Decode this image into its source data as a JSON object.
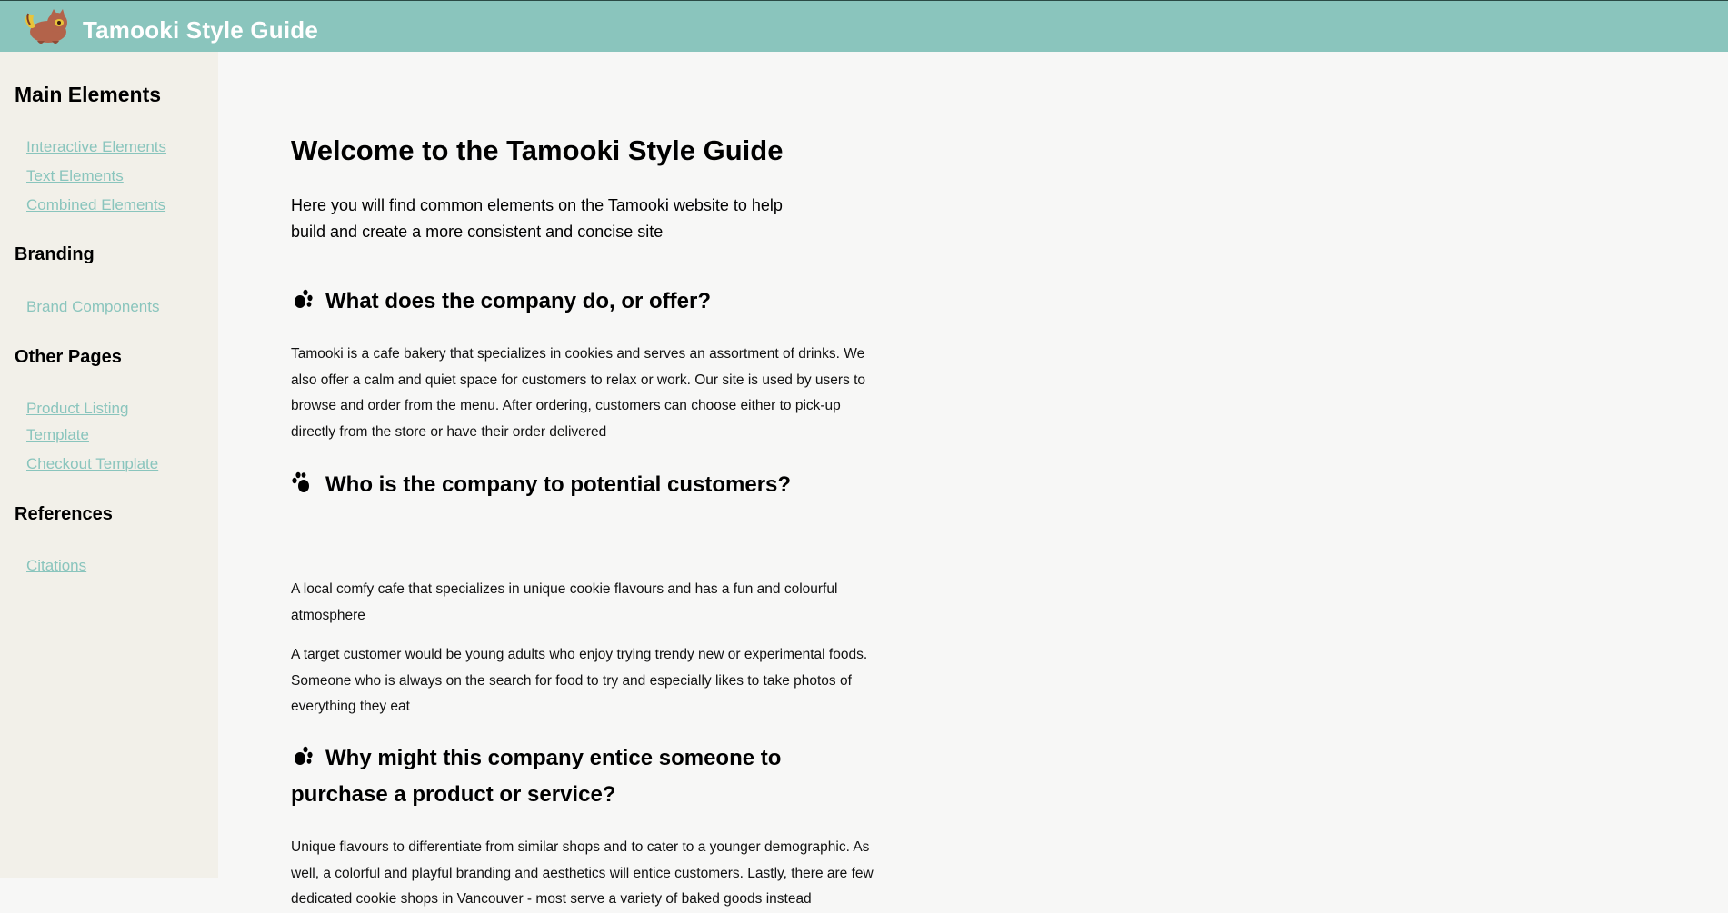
{
  "header": {
    "logo_icon": "raccoon-logo-icon",
    "title": "Tamooki Style Guide",
    "colors": {
      "bar": "#8ac5bd",
      "title": "#ffffff"
    }
  },
  "sidebar": {
    "sections": [
      {
        "heading": "Main Elements",
        "links": [
          "Interactive Elements",
          "Text Elements",
          "Combined Elements"
        ]
      },
      {
        "heading": "Branding",
        "links": [
          "Brand Components"
        ]
      },
      {
        "heading": "Other Pages",
        "links": [
          "Product Listing Template",
          "Checkout Template"
        ]
      },
      {
        "heading": "References",
        "links": [
          "Citations"
        ]
      }
    ],
    "colors": {
      "background": "#f2f0e9",
      "link": "#8ac5bd"
    }
  },
  "main": {
    "title": "Welcome to the Tamooki Style Guide",
    "lead": "Here you will find common elements on the Tamooki website to help build and create a more consistent and concise site",
    "sections": [
      {
        "icon": "paw-print-icon",
        "heading": "What does the company do, or offer?",
        "paragraphs": [
          "Tamooki is a cafe bakery that specializes in cookies and serves an assortment of drinks. We also offer a calm and quiet space for customers to relax or work. Our site is used by users to browse and order from the menu. After ordering, customers can choose either to pick-up directly from the store or have their order delivered"
        ]
      },
      {
        "icon": "paw-print-icon",
        "heading": "Who is the company to potential customers?",
        "paragraphs": [
          "A local comfy cafe that specializes in unique cookie flavours and has a fun and colourful atmosphere",
          "A target customer would be young adults who enjoy trying trendy new or experimental foods. Someone who is always on the search for food to try and especially likes to take photos of everything they eat"
        ]
      },
      {
        "icon": "paw-print-icon",
        "heading": "Why might this company entice someone to purchase a product or service?",
        "paragraphs": [
          "Unique flavours to differentiate from similar shops and to cater to a younger demographic. As well, a colorful and playful branding and aesthetics will entice customers. Lastly, there are few dedicated cookie shops in Vancouver - most serve a variety of baked goods instead"
        ]
      }
    ]
  }
}
